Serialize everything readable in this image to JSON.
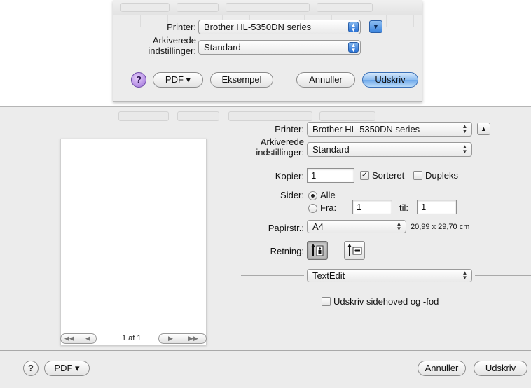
{
  "top_dialog": {
    "printer_label": "Printer:",
    "printer_value": "Brother HL-5350DN series",
    "presets_label_line1": "Arkiverede",
    "presets_label_line2": "indstillinger:",
    "presets_value": "Standard",
    "help_glyph": "?",
    "pdf_label": "PDF ▾",
    "preview_label": "Eksempel",
    "cancel_label": "Annuller",
    "print_label": "Udskriv",
    "disclosure_icon": "triangle-down-icon"
  },
  "bottom_dialog": {
    "printer_label": "Printer:",
    "printer_value": "Brother HL-5350DN series",
    "presets_label_line1": "Arkiverede",
    "presets_label_line2": "indstillinger:",
    "presets_value": "Standard",
    "copies_label": "Kopier:",
    "copies_value": "1",
    "collated_label": "Sorteret",
    "collated_checked": true,
    "duplex_label": "Dupleks",
    "duplex_checked": false,
    "pages_label": "Sider:",
    "pages_all_label": "Alle",
    "pages_from_label": "Fra:",
    "pages_from_value": "1",
    "pages_to_label": "til:",
    "pages_to_value": "1",
    "paper_size_label": "Papirstr.:",
    "paper_size_value": "A4",
    "paper_size_dims": "20,99 x 29,70 cm",
    "orientation_label": "Retning:",
    "section_popup_value": "TextEdit",
    "header_footer_label": "Udskriv sidehoved og -fod",
    "header_footer_checked": false,
    "page_count": "1 af 1",
    "help_glyph": "?",
    "pdf_label": "PDF ▾",
    "cancel_label": "Annuller",
    "print_label": "Udskriv",
    "disclosure_icon": "triangle-up-icon",
    "check_mark": "✓",
    "nav_first": "◀◀",
    "nav_prev": "◀",
    "nav_next": "▶",
    "nav_last": "▶▶",
    "popup_arrows": "▲▼"
  },
  "colors": {
    "dialog_bg": "#ececec",
    "default_button_blue": "#6ea8ea",
    "help_purple": "#9d6fd8"
  }
}
